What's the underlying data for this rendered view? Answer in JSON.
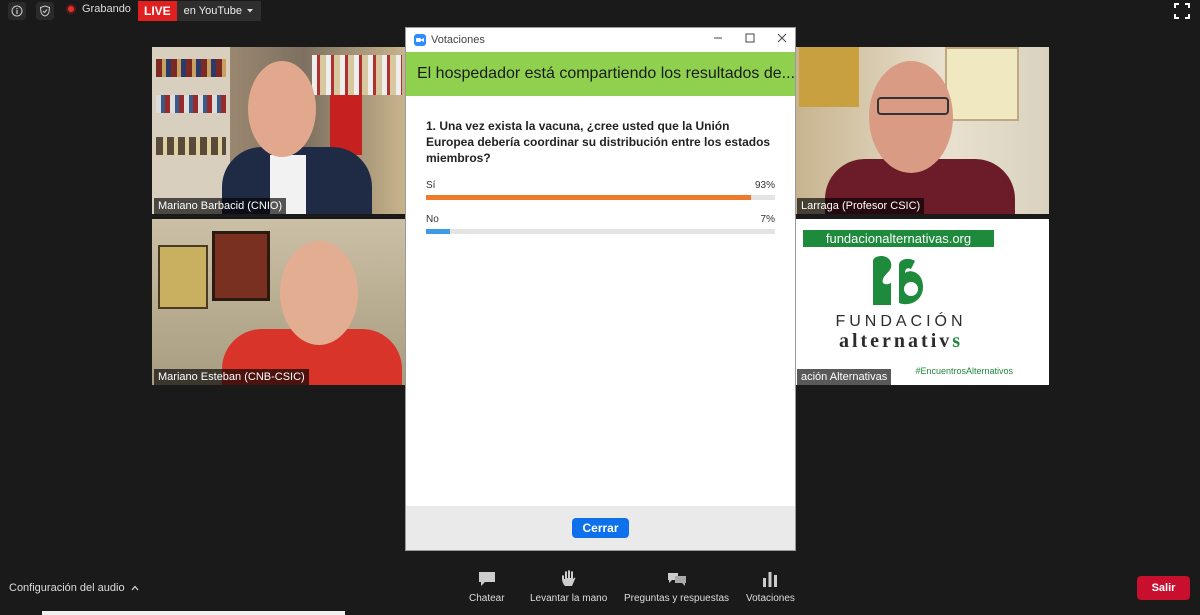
{
  "topbar": {
    "recording_label": "Grabando",
    "live_badge": "LIVE",
    "live_target": "en YouTube",
    "icons": [
      "info-icon",
      "shield-icon",
      "record-icon",
      "chevron-down-icon",
      "fullscreen-icon"
    ]
  },
  "participants": [
    {
      "name": "Mariano Barbacid (CNIO)"
    },
    {
      "name": "Mariano Esteban (CNB-CSIC)"
    },
    {
      "name": "Larraga (Profesor CSIC)"
    },
    {
      "name": "ación Alternativas"
    }
  ],
  "sponsor": {
    "url": "fundacionalternativas.org",
    "word1": "FUNDACIÓN",
    "word2": "alternativ",
    "word2_tail": "s",
    "hashtag": "#EncuentrosAlternativos",
    "brand_color": "#1e8a3c"
  },
  "poll_window": {
    "title": "Votaciones",
    "banner": "El hospedador está compartiendo los resultados de...",
    "question": "1. Una vez exista la vacuna, ¿cree usted que la Unión Europea debería coordinar su distribución entre los estados miembros?",
    "options": [
      {
        "label": "Sí",
        "percent_label": "93%",
        "fraction": 0.93,
        "color": "#ef7a2c"
      },
      {
        "label": "No",
        "percent_label": "7%",
        "fraction": 0.07,
        "color": "#3b9be8"
      }
    ],
    "close_label": "Cerrar",
    "banner_color": "#8fd14f"
  },
  "bottombar": {
    "audio_label": "Configuración del audio",
    "tools": [
      {
        "label": "Chatear",
        "icon": "chat-icon"
      },
      {
        "label": "Levantar la mano",
        "icon": "hand-icon"
      },
      {
        "label": "Preguntas y respuestas",
        "icon": "qa-icon"
      },
      {
        "label": "Votaciones",
        "icon": "poll-icon"
      }
    ],
    "leave_label": "Salir",
    "leave_color": "#c8102e"
  }
}
